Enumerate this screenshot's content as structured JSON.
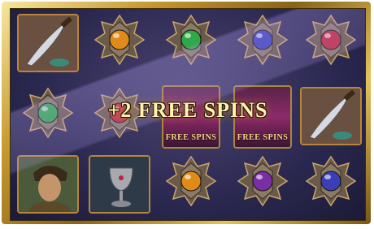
{
  "banner": {
    "text": "+2 FREE SPINS"
  },
  "free_spins_symbol": {
    "label": "FREE SPINS"
  },
  "colors": {
    "frame_gold": "#c89a2e",
    "board_bg": "#2b2850",
    "gem_orange": "#e08a1a",
    "gem_green": "#2fa84a",
    "gem_blue": "#3a3fb8",
    "gem_red": "#c0263a",
    "gem_purple": "#7a2ea6",
    "banner_text": "#fff1b0"
  },
  "reels": [
    [
      "dagger-icon",
      "green-gem-icon",
      "pirate-portrait-icon"
    ],
    [
      "orange-gem-icon",
      "red-gem-icon",
      "goblet-icon"
    ],
    [
      "green-gem-icon",
      "free-spins-symbol",
      "orange-gem-icon"
    ],
    [
      "blue-gem-icon",
      "free-spins-symbol",
      "purple-gem-icon"
    ],
    [
      "red-gem-icon",
      "dagger-icon",
      "blue-gem-icon"
    ]
  ]
}
